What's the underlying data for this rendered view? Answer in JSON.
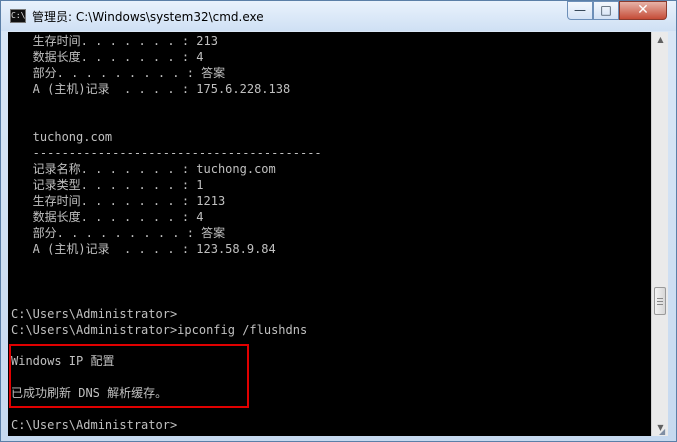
{
  "window": {
    "title": "管理员: C:\\Windows\\system32\\cmd.exe",
    "app_icon_text": "C:\\",
    "buttons": {
      "minimize": "—",
      "maximize": "□",
      "close": "✕"
    }
  },
  "console": {
    "lines": [
      "   生存时间. . . . . . . : 213",
      "   数据长度. . . . . . . : 4",
      "   部分. . . . . . . . . : 答案",
      "   A (主机)记录  . . . . : 175.6.228.138",
      "",
      "",
      "   tuchong.com",
      "   ----------------------------------------",
      "   记录名称. . . . . . . : tuchong.com",
      "   记录类型. . . . . . . : 1",
      "   生存时间. . . . . . . : 1213",
      "   数据长度. . . . . . . : 4",
      "   部分. . . . . . . . . : 答案",
      "   A (主机)记录  . . . . : 123.58.9.84",
      "",
      "",
      "",
      "",
      "C:\\Users\\Administrator>",
      "C:\\Users\\Administrator>ipconfig /flushdns",
      "",
      "Windows IP 配置",
      "",
      "已成功刷新 DNS 解析缓存。",
      "",
      "C:\\Users\\Administrator>"
    ]
  },
  "colors": {
    "console_background": "#000000",
    "console_text": "#c0c0c0",
    "highlight_border": "#e10000",
    "titlebar": "#dbe8f7",
    "close_button": "#c54c37"
  },
  "icons": {
    "app": "cmd-icon",
    "scroll_up": "arrow-up-icon",
    "scroll_down": "arrow-down-icon",
    "resize": "resize-grip-icon"
  }
}
